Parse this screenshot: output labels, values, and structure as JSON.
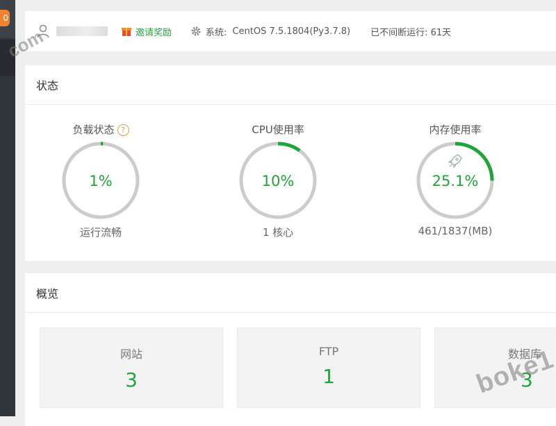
{
  "sidebar": {
    "badge": "0"
  },
  "watermarks": {
    "left": "com",
    "right": "boke1"
  },
  "topbar": {
    "invite_label": "邀请奖励",
    "system_label": "系统:",
    "system_value": "CentOS 7.5.1804(Py3.7.8)",
    "uptime": "已不间断运行: 61天"
  },
  "status": {
    "title": "状态",
    "gauges": [
      {
        "title": "负载状态",
        "value": "1%",
        "percent": 1,
        "footer": "运行流畅"
      },
      {
        "title": "CPU使用率",
        "value": "10%",
        "percent": 10,
        "footer": "1 核心"
      },
      {
        "title": "内存使用率",
        "value": "25.1%",
        "percent": 25.1,
        "footer": "461/1837(MB)"
      }
    ]
  },
  "overview": {
    "title": "概览",
    "cards": [
      {
        "label": "网站",
        "value": "3"
      },
      {
        "label": "FTP",
        "value": "1"
      },
      {
        "label": "数据库",
        "value": "3"
      }
    ]
  },
  "colors": {
    "accent": "#20a53a",
    "track": "#cccccc",
    "warn": "#f0812d"
  }
}
